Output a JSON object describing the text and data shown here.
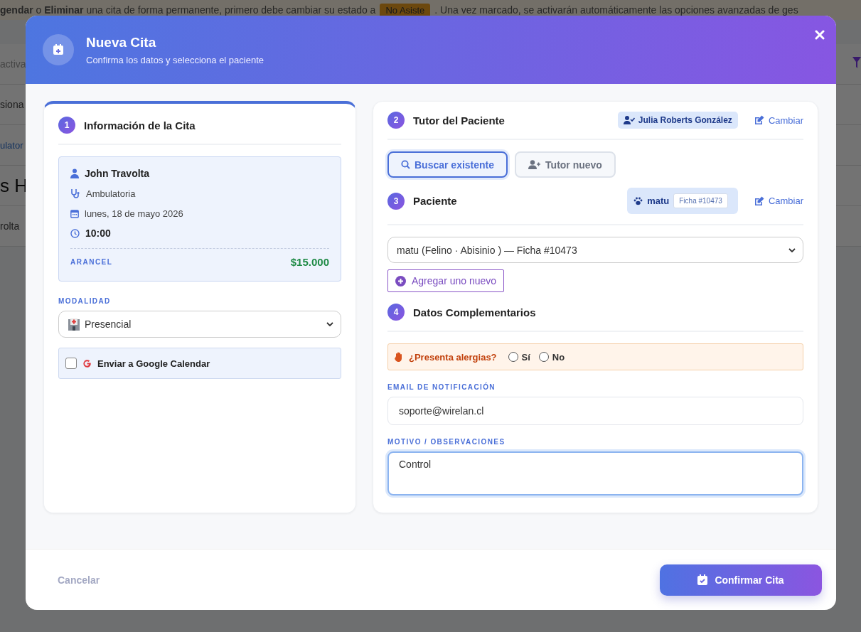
{
  "background": {
    "banner": {
      "text": "**gendar** o **Eliminar** una cita de forma permanente, primero debe cambiar su estado a",
      "badge": "No Asiste",
      "text_after": ". Una vez marcado, se activarán automáticamente las opciones avanzadas de ges"
    },
    "fragments": [
      {
        "kind": "field",
        "text": "activa"
      },
      {
        "kind": "text",
        "text": "siona"
      },
      {
        "kind": "link",
        "text": "ulator"
      },
      {
        "kind": "heading",
        "text": "s H"
      },
      {
        "kind": "text",
        "text": "rolta"
      }
    ]
  },
  "modal": {
    "title": "Nueva Cita",
    "subtitle": "Confirma los datos y selecciona el paciente"
  },
  "info": {
    "step": "1",
    "title": "Información de la Cita",
    "doctor": "John Travolta",
    "service": "Ambulatoria",
    "date": "lunes, 18 de mayo 2026",
    "time": "10:00",
    "fee_label": "ARANCEL",
    "fee": "$15.000",
    "modality_label": "MODALIDAD",
    "modality": "Presencial",
    "google": {
      "label": "Enviar a Google Calendar",
      "checked": false
    }
  },
  "tutor": {
    "step": "2",
    "title": "Tutor del Paciente",
    "selected_name": "Julia Roberts González",
    "change": "Cambiar",
    "buttons": [
      {
        "label": "Buscar existente",
        "selected": true
      },
      {
        "label": "Tutor nuevo",
        "selected": false
      }
    ]
  },
  "patient": {
    "step": "3",
    "title": "Paciente",
    "chip_name": "matu",
    "chip_badge": "Ficha #10473",
    "change": "Cambiar",
    "select": "matu (Felino · Abisinio ) — Ficha #10473",
    "add": "Agregar uno nuevo"
  },
  "extra": {
    "step": "4",
    "title": "Datos Complementarios",
    "allergy_question": "¿Presenta alergias?",
    "allergy_options": [
      {
        "label": "Sí",
        "selected": false
      },
      {
        "label": "No",
        "selected": false
      }
    ],
    "email_label": "EMAIL DE NOTIFICACIÓN",
    "email": "soporte@wirelan.cl",
    "motive_label": "MOTIVO / OBSERVACIONES",
    "motive": "Control"
  },
  "footer": {
    "cancel": "Cancelar",
    "confirm": "Confirmar Cita"
  }
}
